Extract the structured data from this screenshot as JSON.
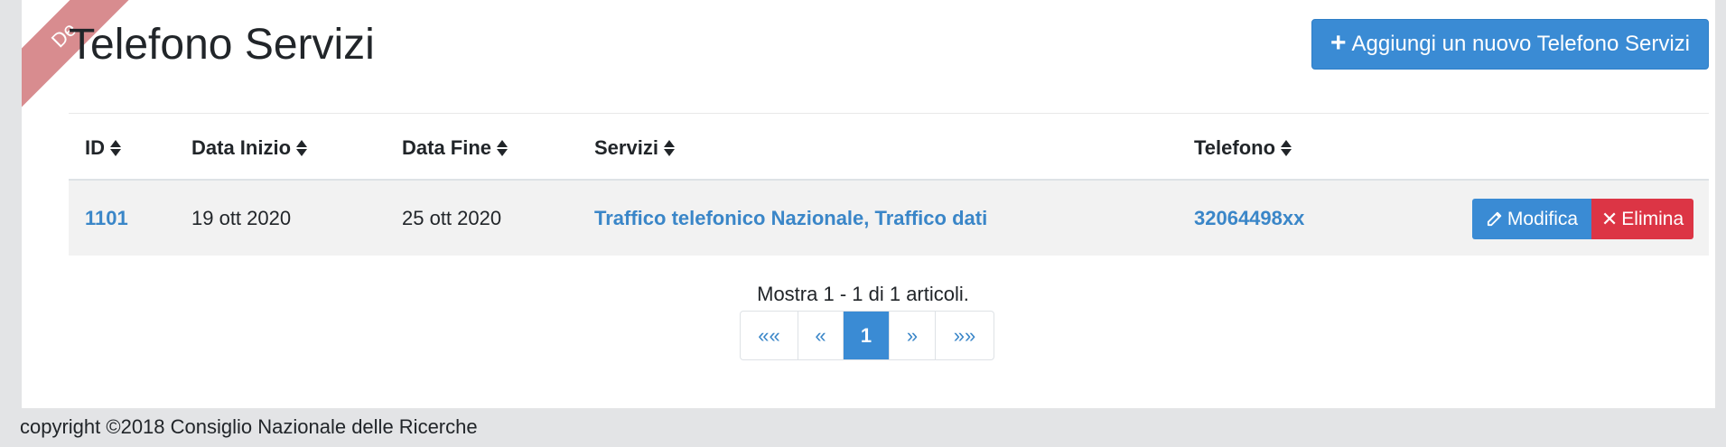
{
  "ribbon": {
    "text": "De"
  },
  "page_title": "Telefono Servizi",
  "add_button": {
    "label": "Aggiungi un nuovo Telefono Servizi",
    "icon": "plus-icon"
  },
  "table": {
    "headers": [
      "ID",
      "Data Inizio",
      "Data Fine",
      "Servizi",
      "Telefono"
    ],
    "rows": [
      {
        "id": "1101",
        "data_inizio": "19 ott 2020",
        "data_fine": "25 ott 2020",
        "servizi": "Traffico telefonico Nazionale, Traffico dati",
        "telefono": "32064498xx",
        "edit_label": "Modifica",
        "delete_label": "Elimina"
      }
    ]
  },
  "summary": "Mostra 1 - 1 di 1 articoli.",
  "pagination": {
    "first": "««",
    "prev": "«",
    "current": "1",
    "next": "»",
    "last": "»»"
  },
  "footer": "copyright ©2018 Consiglio Nazionale delle Ricerche",
  "colors": {
    "primary": "#3a8bd4",
    "danger": "#dc3545",
    "ribbon": "#d88c8f",
    "link": "#3a86c8"
  }
}
